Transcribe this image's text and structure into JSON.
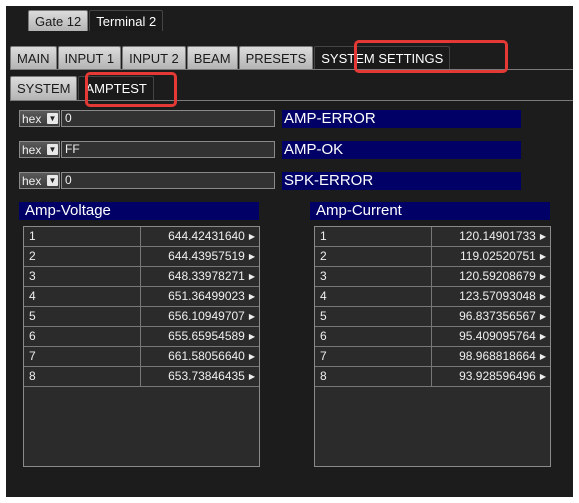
{
  "top_tabs": [
    "Gate 12",
    "Terminal 2"
  ],
  "main_tabs": [
    "MAIN",
    "INPUT 1",
    "INPUT 2",
    "BEAM",
    "PRESETS",
    "SYSTEM SETTINGS"
  ],
  "sub_tabs": [
    "SYSTEM",
    "AMPTEST"
  ],
  "controls": [
    {
      "format": "hex",
      "value": "0",
      "status": "AMP-ERROR"
    },
    {
      "format": "hex",
      "value": "FF",
      "status": "AMP-OK"
    },
    {
      "format": "hex",
      "value": "0",
      "status": "SPK-ERROR"
    }
  ],
  "voltage": {
    "title": "Amp-Voltage",
    "rows": [
      {
        "ch": "1",
        "value": "644.42431640"
      },
      {
        "ch": "2",
        "value": "644.43957519"
      },
      {
        "ch": "3",
        "value": "648.33978271"
      },
      {
        "ch": "4",
        "value": "651.36499023"
      },
      {
        "ch": "5",
        "value": "656.10949707"
      },
      {
        "ch": "6",
        "value": "655.65954589"
      },
      {
        "ch": "7",
        "value": "661.58056640"
      },
      {
        "ch": "8",
        "value": "653.73846435"
      }
    ]
  },
  "current": {
    "title": "Amp-Current",
    "rows": [
      {
        "ch": "1",
        "value": "120.14901733"
      },
      {
        "ch": "2",
        "value": "119.02520751"
      },
      {
        "ch": "3",
        "value": "120.59208679"
      },
      {
        "ch": "4",
        "value": "123.57093048"
      },
      {
        "ch": "5",
        "value": "96.837356567"
      },
      {
        "ch": "6",
        "value": "95.409095764"
      },
      {
        "ch": "7",
        "value": "98.968818664"
      },
      {
        "ch": "8",
        "value": "93.928596496"
      }
    ]
  },
  "accent_colors": {
    "status_bar": "#000066",
    "highlight": "#e53935"
  }
}
